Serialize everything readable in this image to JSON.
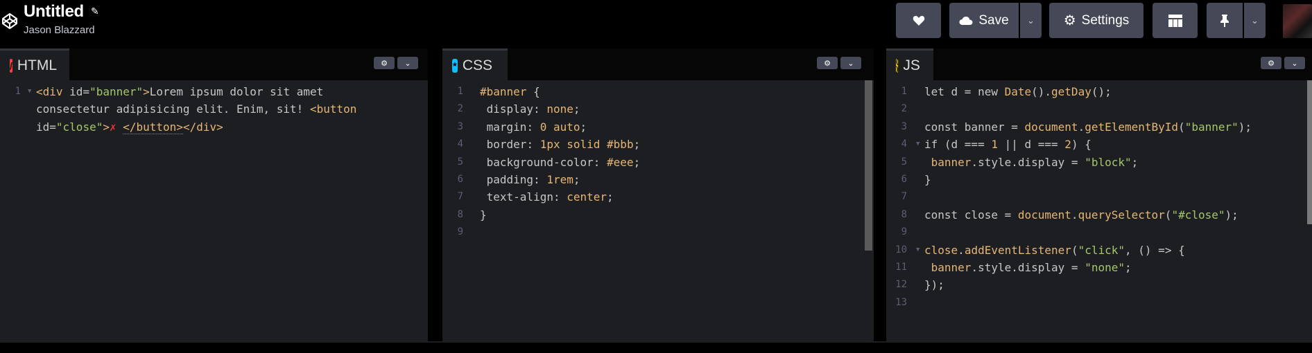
{
  "header": {
    "title": "Untitled",
    "author": "Jason Blazzard",
    "buttons": {
      "like_icon": "heart-icon",
      "save_label": "Save",
      "save_icon": "cloud-icon",
      "settings_label": "Settings",
      "settings_icon": "gear-icon",
      "layout_icon": "layout-grid-icon",
      "pin_icon": "pin-icon"
    }
  },
  "editors": {
    "html": {
      "tab": "HTML",
      "icon_glyph": "/",
      "lines": [
        {
          "n": "1",
          "parts": [
            {
              "c": "tg",
              "t": "<div "
            },
            {
              "c": "at",
              "t": "id="
            },
            {
              "c": "av",
              "t": "\"banner\""
            },
            {
              "c": "tg",
              "t": ">"
            },
            {
              "c": "pu",
              "t": "Lorem ipsum dolor sit amet"
            }
          ]
        },
        {
          "n": "",
          "parts": [
            {
              "c": "pu",
              "t": "consectetur adipisicing elit. Enim, sit! "
            },
            {
              "c": "tg",
              "t": "<button"
            }
          ]
        },
        {
          "n": "",
          "parts": [
            {
              "c": "at",
              "t": "id="
            },
            {
              "c": "av",
              "t": "\"close\""
            },
            {
              "c": "tg",
              "t": ">"
            },
            {
              "c": "cross",
              "t": "✗ "
            },
            {
              "c": "tg dotted",
              "t": "</button>"
            },
            {
              "c": "tg",
              "t": "</div>"
            }
          ]
        }
      ]
    },
    "css": {
      "tab": "CSS",
      "icon_glyph": "*",
      "lines": [
        {
          "n": "1",
          "parts": [
            {
              "c": "vl",
              "t": "#banner"
            },
            {
              "c": "pu",
              "t": " {"
            }
          ]
        },
        {
          "n": "2",
          "parts": [
            {
              "c": "pr",
              "t": " display"
            },
            {
              "c": "pu",
              "t": ": "
            },
            {
              "c": "vl",
              "t": "none"
            },
            {
              "c": "pu",
              "t": ";"
            }
          ]
        },
        {
          "n": "3",
          "parts": [
            {
              "c": "pr",
              "t": " margin"
            },
            {
              "c": "pu",
              "t": ": "
            },
            {
              "c": "nm",
              "t": "0"
            },
            {
              "c": "vl",
              "t": " auto"
            },
            {
              "c": "pu",
              "t": ";"
            }
          ]
        },
        {
          "n": "4",
          "parts": [
            {
              "c": "pr",
              "t": " border"
            },
            {
              "c": "pu",
              "t": ": "
            },
            {
              "c": "nm",
              "t": "1px"
            },
            {
              "c": "vl",
              "t": " solid #bbb"
            },
            {
              "c": "pu",
              "t": ";"
            }
          ]
        },
        {
          "n": "5",
          "parts": [
            {
              "c": "pr",
              "t": " background-color"
            },
            {
              "c": "pu",
              "t": ": "
            },
            {
              "c": "vl",
              "t": "#eee"
            },
            {
              "c": "pu",
              "t": ";"
            }
          ]
        },
        {
          "n": "6",
          "parts": [
            {
              "c": "pr",
              "t": " padding"
            },
            {
              "c": "pu",
              "t": ": "
            },
            {
              "c": "nm",
              "t": "1rem"
            },
            {
              "c": "pu",
              "t": ";"
            }
          ]
        },
        {
          "n": "7",
          "parts": [
            {
              "c": "pr",
              "t": " text-align"
            },
            {
              "c": "pu",
              "t": ": "
            },
            {
              "c": "vl",
              "t": "center"
            },
            {
              "c": "pu",
              "t": ";"
            }
          ]
        },
        {
          "n": "8",
          "parts": [
            {
              "c": "pu",
              "t": "}"
            }
          ]
        },
        {
          "n": "9",
          "parts": []
        }
      ]
    },
    "js": {
      "tab": "JS",
      "icon_glyph": "( )",
      "lines": [
        {
          "n": "1",
          "parts": [
            {
              "c": "kw",
              "t": "let d = new "
            },
            {
              "c": "fn",
              "t": "Date"
            },
            {
              "c": "pu",
              "t": "()."
            },
            {
              "c": "fn",
              "t": "getDay"
            },
            {
              "c": "pu",
              "t": "();"
            }
          ]
        },
        {
          "n": "2",
          "parts": []
        },
        {
          "n": "3",
          "parts": [
            {
              "c": "kw",
              "t": "const banner = "
            },
            {
              "c": "fn",
              "t": "document"
            },
            {
              "c": "pu",
              "t": "."
            },
            {
              "c": "fn",
              "t": "getElementById"
            },
            {
              "c": "pu",
              "t": "("
            },
            {
              "c": "st",
              "t": "\"banner\""
            },
            {
              "c": "pu",
              "t": ");"
            }
          ]
        },
        {
          "n": "4",
          "parts": [
            {
              "c": "kw",
              "t": "if (d === "
            },
            {
              "c": "nm",
              "t": "1"
            },
            {
              "c": "kw",
              "t": " || d === "
            },
            {
              "c": "nm",
              "t": "2"
            },
            {
              "c": "pu",
              "t": ") {"
            }
          ]
        },
        {
          "n": "5",
          "parts": [
            {
              "c": "fn",
              "t": " banner"
            },
            {
              "c": "pu",
              "t": ".style.display = "
            },
            {
              "c": "st",
              "t": "\"block\""
            },
            {
              "c": "pu",
              "t": ";"
            }
          ]
        },
        {
          "n": "6",
          "parts": [
            {
              "c": "pu",
              "t": "}"
            }
          ]
        },
        {
          "n": "7",
          "parts": []
        },
        {
          "n": "8",
          "parts": [
            {
              "c": "kw",
              "t": "const close = "
            },
            {
              "c": "fn",
              "t": "document"
            },
            {
              "c": "pu",
              "t": "."
            },
            {
              "c": "fn",
              "t": "querySelector"
            },
            {
              "c": "pu",
              "t": "("
            },
            {
              "c": "st",
              "t": "\"#close\""
            },
            {
              "c": "pu",
              "t": ");"
            }
          ]
        },
        {
          "n": "9",
          "parts": []
        },
        {
          "n": "10",
          "parts": [
            {
              "c": "fn",
              "t": "close"
            },
            {
              "c": "pu",
              "t": "."
            },
            {
              "c": "fn",
              "t": "addEventListener"
            },
            {
              "c": "pu",
              "t": "("
            },
            {
              "c": "st",
              "t": "\"click\""
            },
            {
              "c": "pu",
              "t": ", () => {"
            }
          ]
        },
        {
          "n": "11",
          "parts": [
            {
              "c": "fn",
              "t": " banner"
            },
            {
              "c": "pu",
              "t": ".style.display = "
            },
            {
              "c": "st",
              "t": "\"none\""
            },
            {
              "c": "pu",
              "t": ";"
            }
          ]
        },
        {
          "n": "12",
          "parts": [
            {
              "c": "pu",
              "t": "});"
            }
          ]
        },
        {
          "n": "13",
          "parts": []
        }
      ]
    }
  }
}
